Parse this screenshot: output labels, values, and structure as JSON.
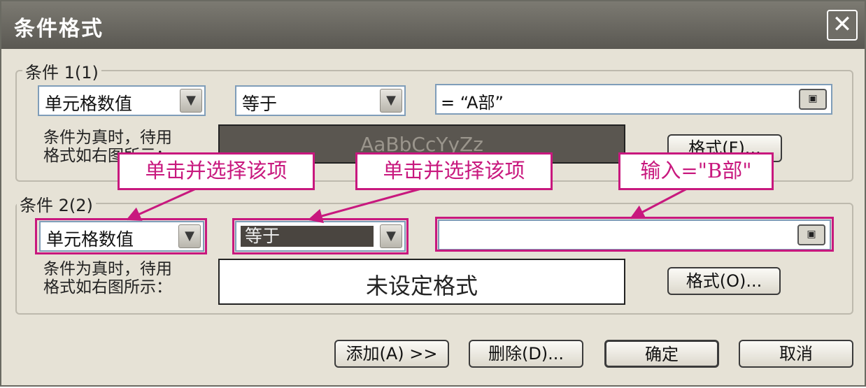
{
  "window": {
    "title": "条件格式"
  },
  "condition1": {
    "group_label": "条件 1(1)",
    "type_value": "单元格数值",
    "operator_value": "等于",
    "formula_value": "= “A部”",
    "hint_line1": "条件为真时，待用",
    "hint_line2": "格式如右图所示：",
    "preview_text": "AaBbCcYyZz",
    "format_button": "格式(F)..."
  },
  "condition2": {
    "group_label": "条件 2(2)",
    "type_value": "单元格数值",
    "operator_value": "等于",
    "formula_value": "",
    "hint_line1": "条件为真时，待用",
    "hint_line2": "格式如右图所示：",
    "preview_text": "未设定格式",
    "format_button": "格式(O)..."
  },
  "annotations": {
    "callout_type": "单击并选择该项",
    "callout_operator": "单击并选择该项",
    "callout_formula": "输入=\"B部\""
  },
  "buttons": {
    "add": "添加(A) >>",
    "delete": "删除(D)...",
    "ok": "确定",
    "cancel": "取消"
  },
  "icons": {
    "close": "✕",
    "dropdown": "▼",
    "collapse_ref": "▣"
  },
  "colors": {
    "callout": "#c8187e",
    "titlebar": "#5a5852",
    "dialog_bg": "#e6e2d6"
  }
}
